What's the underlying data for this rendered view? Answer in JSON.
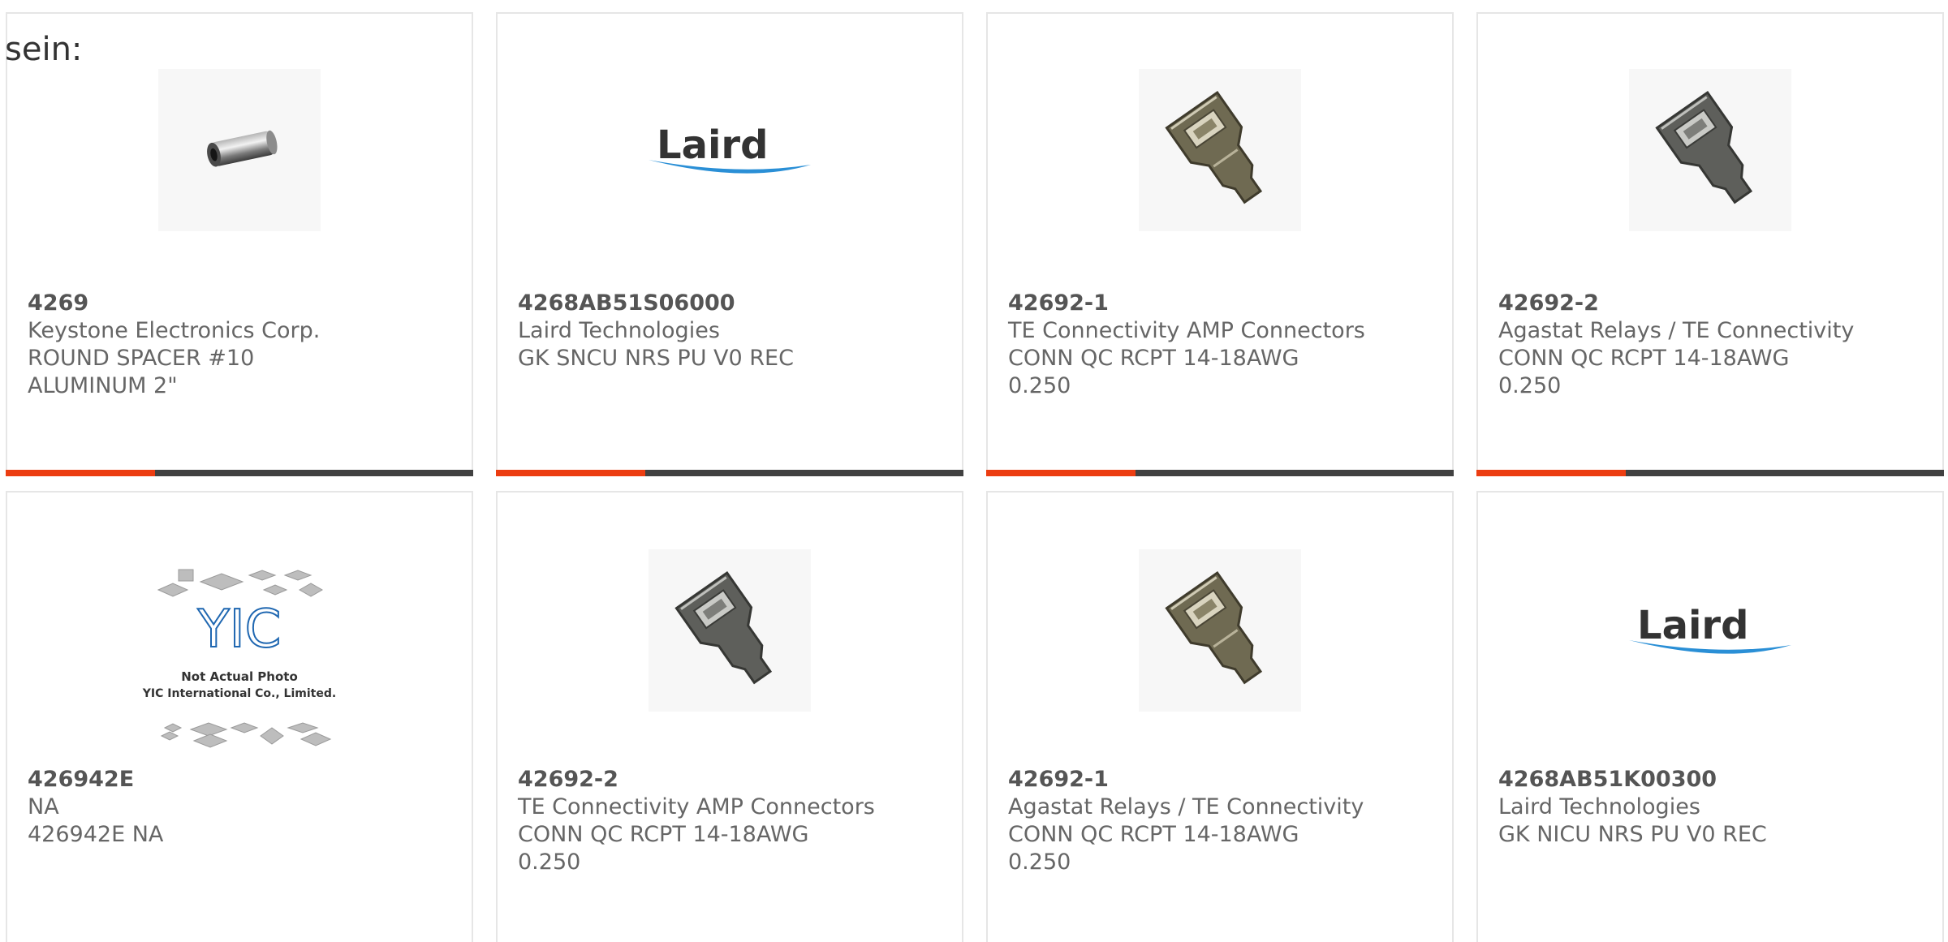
{
  "lead_text": "sein:",
  "colors": {
    "accent": "#ec3d11",
    "bar_track": "#414141",
    "card_border": "#e6e6e6",
    "text": "#666666"
  },
  "products": [
    {
      "part_number": "4269",
      "manufacturer": "Keystone Electronics Corp.",
      "description": "ROUND SPACER #10 ALUMINUM 2\"",
      "image": "spacer-image",
      "progress": 0.32
    },
    {
      "part_number": "4268AB51S06000",
      "manufacturer": "Laird Technologies",
      "description": "GK SNCU NRS PU V0 REC",
      "image": "laird-logo",
      "logo_text": "Laird",
      "progress": 0.32
    },
    {
      "part_number": "42692-1",
      "manufacturer": "TE Connectivity AMP Connectors",
      "description": "CONN QC RCPT 14-18AWG 0.250",
      "image": "connector-image-brass",
      "progress": 0.32
    },
    {
      "part_number": "42692-2",
      "manufacturer": "Agastat Relays / TE Connectivity",
      "description": "CONN QC RCPT 14-18AWG 0.250",
      "image": "connector-image-grey",
      "progress": 0.32
    },
    {
      "part_number": "426942E",
      "manufacturer": "NA",
      "description": "426942E NA",
      "image": "not-actual-photo-placeholder",
      "placeholder_line1": "Not Actual Photo",
      "placeholder_line2": "YIC International Co., Limited.",
      "placeholder_logo": "YIC"
    },
    {
      "part_number": "42692-2",
      "manufacturer": "TE Connectivity AMP Connectors",
      "description": "CONN QC RCPT 14-18AWG 0.250",
      "image": "connector-image-grey"
    },
    {
      "part_number": "42692-1",
      "manufacturer": "Agastat Relays / TE Connectivity",
      "description": "CONN QC RCPT 14-18AWG 0.250",
      "image": "connector-image-brass"
    },
    {
      "part_number": "4268AB51K00300",
      "manufacturer": "Laird Technologies",
      "description": "GK NICU NRS PU V0 REC",
      "image": "laird-logo",
      "logo_text": "Laird"
    }
  ]
}
